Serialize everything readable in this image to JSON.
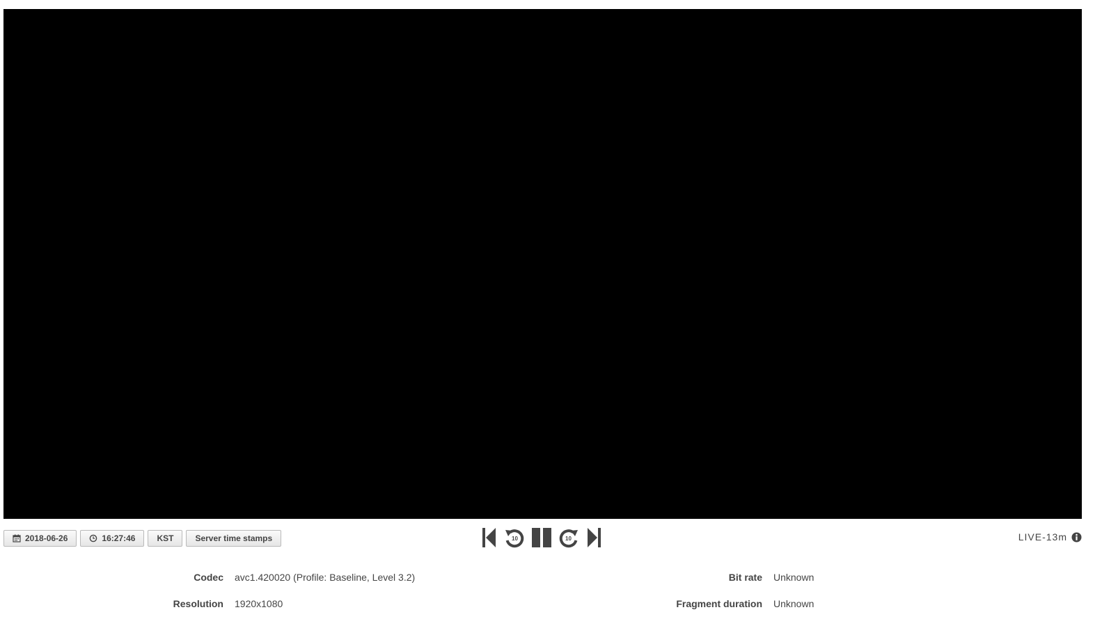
{
  "toolbar": {
    "date_label": "2018-06-26",
    "time_label": "16:27:46",
    "timezone_label": "KST",
    "timestamps_label": "Server time stamps"
  },
  "player": {
    "skip_back_amount": "10",
    "skip_forward_amount": "10",
    "live_label": "LIVE",
    "live_offset": "-13m"
  },
  "details": {
    "codec_label": "Codec",
    "codec_value": "avc1.420020 (Profile: Baseline, Level 3.2)",
    "resolution_label": "Resolution",
    "resolution_value": "1920x1080",
    "bitrate_label": "Bit rate",
    "bitrate_value": "Unknown",
    "fragment_label": "Fragment duration",
    "fragment_value": "Unknown"
  },
  "icons": {
    "date": "calendar-icon",
    "time": "clock-icon",
    "first": "skip-to-start-icon",
    "rewind": "rewind-10-icon",
    "pause": "pause-icon",
    "forward": "forward-10-icon",
    "last": "skip-to-end-icon",
    "info": "info-icon"
  },
  "colors": {
    "video_background": "#000000",
    "text": "#444444",
    "controls": "#444444"
  }
}
